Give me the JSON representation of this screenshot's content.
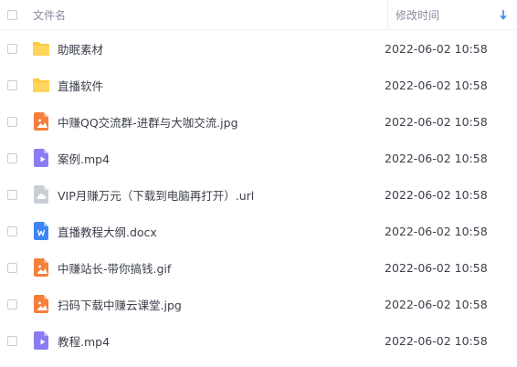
{
  "header": {
    "name_label": "文件名",
    "time_label": "修改时间",
    "sort_icon": "sort-desc-arrow-icon"
  },
  "colors": {
    "folder": "#ffcb3d",
    "image": "#f57f3b",
    "video": "#8b7cf6",
    "link": "#c9ced6",
    "doc": "#3e85f5",
    "sort_arrow": "#3e85f5"
  },
  "files": [
    {
      "name": "助眠素材",
      "time": "2022-06-02 10:58",
      "type": "folder",
      "icon": "folder-icon"
    },
    {
      "name": "直播软件",
      "time": "2022-06-02 10:58",
      "type": "folder",
      "icon": "folder-icon"
    },
    {
      "name": "中赚QQ交流群-进群与大咖交流.jpg",
      "time": "2022-06-02 10:58",
      "type": "image",
      "icon": "image-file-icon"
    },
    {
      "name": "案例.mp4",
      "time": "2022-06-02 10:58",
      "type": "video",
      "icon": "video-file-icon"
    },
    {
      "name": "VIP月赚万元（下载到电脑再打开）.url",
      "time": "2022-06-02 10:58",
      "type": "link",
      "icon": "cloud-link-file-icon"
    },
    {
      "name": "直播教程大纲.docx",
      "time": "2022-06-02 10:58",
      "type": "doc",
      "icon": "word-doc-file-icon"
    },
    {
      "name": "中赚站长-带你搞钱.gif",
      "time": "2022-06-02 10:58",
      "type": "image",
      "icon": "image-file-icon"
    },
    {
      "name": "扫码下载中赚云课堂.jpg",
      "time": "2022-06-02 10:58",
      "type": "image",
      "icon": "image-file-icon"
    },
    {
      "name": "教程.mp4",
      "time": "2022-06-02 10:58",
      "type": "video",
      "icon": "video-file-icon"
    }
  ]
}
